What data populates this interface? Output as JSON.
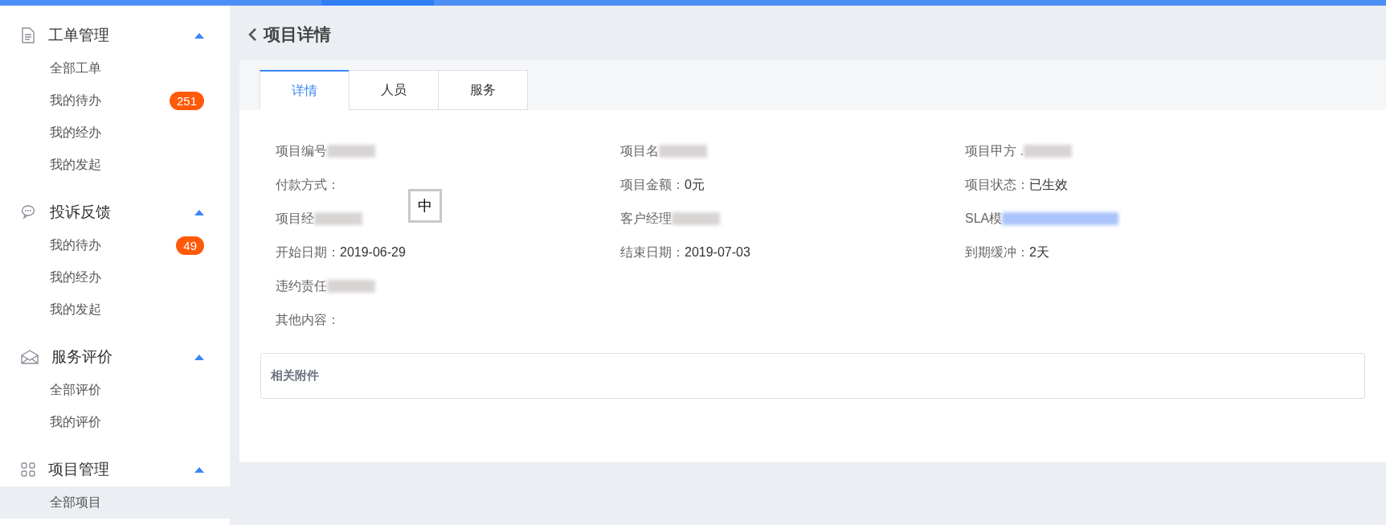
{
  "sidebar": {
    "sections": [
      {
        "title": "工单管理",
        "expanded": true,
        "items": [
          {
            "label": "全部工单",
            "selected": false
          },
          {
            "label": "我的待办",
            "badge": "251",
            "selected": false
          },
          {
            "label": "我的经办",
            "selected": false
          },
          {
            "label": "我的发起",
            "selected": false
          }
        ]
      },
      {
        "title": "投诉反馈",
        "expanded": true,
        "items": [
          {
            "label": "我的待办",
            "badge": "49",
            "selected": false
          },
          {
            "label": "我的经办",
            "selected": false
          },
          {
            "label": "我的发起",
            "selected": false
          }
        ]
      },
      {
        "title": "服务评价",
        "expanded": true,
        "items": [
          {
            "label": "全部评价",
            "selected": false
          },
          {
            "label": "我的评价",
            "selected": false
          }
        ]
      },
      {
        "title": "项目管理",
        "expanded": true,
        "items": [
          {
            "label": "全部项目",
            "selected": true
          }
        ]
      }
    ]
  },
  "page_title": "项目详情",
  "tabs": [
    {
      "label": "详情",
      "selected": true
    },
    {
      "label": "人员",
      "selected": false
    },
    {
      "label": "服务",
      "selected": false
    }
  ],
  "fields": [
    [
      {
        "label": "项目编号",
        "redacted": true
      },
      {
        "label": "项目名",
        "redacted": true
      },
      {
        "label": "项目甲方 .",
        "redacted": true
      }
    ],
    [
      {
        "label": "付款方式："
      },
      {
        "label": "项目金额：",
        "value": "0元"
      },
      {
        "label": "项目状态：",
        "value": "已生效"
      }
    ],
    [
      {
        "label": "项目经",
        "redacted": true
      },
      {
        "label": "客户经理",
        "redacted": true
      },
      {
        "label": "SLA模",
        "redacted": true,
        "kind": "link"
      }
    ],
    [
      {
        "label": "开始日期：",
        "value": "2019-06-29"
      },
      {
        "label": "结束日期：",
        "value": "2019-07-03"
      },
      {
        "label": "到期缓冲：",
        "value": "2天"
      }
    ],
    [
      {
        "label": "违约责任",
        "redacted": true
      }
    ],
    [
      {
        "label": "其他内容："
      }
    ]
  ],
  "attachments": {
    "title": "相关附件"
  },
  "ime_indicator": "中"
}
